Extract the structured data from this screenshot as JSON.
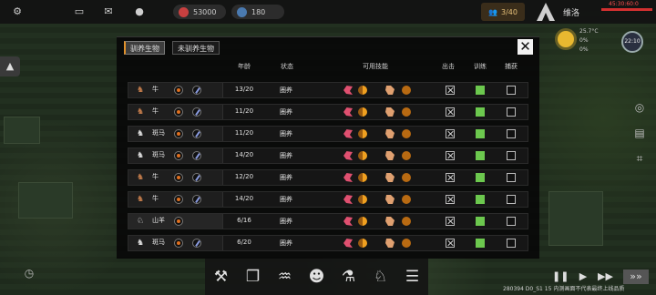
{
  "hud": {
    "silver": "53000",
    "research": "180",
    "population": "3/40",
    "location": "维洛",
    "clock": "45:30:60:0",
    "weather": {
      "temperature": "25.7°C",
      "line2": "0%",
      "line3": "0%",
      "time": "22:10"
    },
    "footer_note": "280394 D0_S1 15 内测画面不代表最终上线品质"
  },
  "tabs": [
    "驯养生物",
    "未驯养生物"
  ],
  "active_tab": 0,
  "columns": {
    "age": "年龄",
    "status": "状态",
    "skills": "可用技能",
    "sortie": "出击",
    "training": "训练",
    "hunt": "捕获"
  },
  "animals": [
    {
      "species": "cattle",
      "name": "牛",
      "age": "13/20",
      "status": "圈养",
      "sortie": false,
      "training": true,
      "hunt": false
    },
    {
      "species": "cattle",
      "name": "牛",
      "age": "11/20",
      "status": "圈养",
      "sortie": false,
      "training": true,
      "hunt": false
    },
    {
      "species": "zebra",
      "name": "斑马",
      "age": "11/20",
      "status": "圈养",
      "sortie": false,
      "training": true,
      "hunt": false
    },
    {
      "species": "zebra",
      "name": "斑马",
      "age": "14/20",
      "status": "圈养",
      "sortie": false,
      "training": true,
      "hunt": false
    },
    {
      "species": "cattle",
      "name": "牛",
      "age": "12/20",
      "status": "圈养",
      "sortie": false,
      "training": true,
      "hunt": false
    },
    {
      "species": "cattle",
      "name": "牛",
      "age": "14/20",
      "status": "圈养",
      "sortie": false,
      "training": true,
      "hunt": false
    },
    {
      "species": "goat",
      "name": "山羊",
      "age": "6/16",
      "status": "圈养",
      "sortie": false,
      "training": true,
      "hunt": false
    },
    {
      "species": "zebra",
      "name": "斑马",
      "age": "6/20",
      "status": "圈养",
      "sortie": false,
      "training": true,
      "hunt": false
    }
  ],
  "colors": {
    "accent_tab": "#e0902a",
    "training_on": "#6cc84e",
    "hud_red": "#d23030"
  },
  "icons": {
    "top": [
      "gear-icon",
      "keyboard-icon",
      "mail-icon",
      "person-icon",
      "silver-coin-icon",
      "research-icon",
      "population-icon"
    ],
    "bottom": [
      "tools-icon",
      "layers-icon",
      "sound-wave-icon",
      "people-icon",
      "flask-icon",
      "paw-icon",
      "speech-icon"
    ]
  }
}
